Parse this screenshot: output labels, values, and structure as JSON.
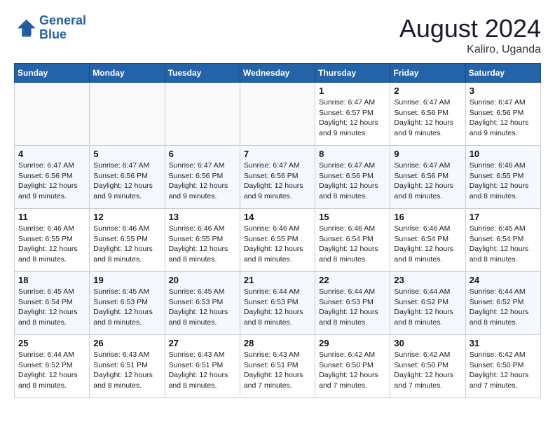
{
  "header": {
    "logo_text_general": "General",
    "logo_text_blue": "Blue",
    "month_year": "August 2024",
    "location": "Kaliro, Uganda"
  },
  "weekdays": [
    "Sunday",
    "Monday",
    "Tuesday",
    "Wednesday",
    "Thursday",
    "Friday",
    "Saturday"
  ],
  "weeks": [
    [
      {
        "day": "",
        "info": ""
      },
      {
        "day": "",
        "info": ""
      },
      {
        "day": "",
        "info": ""
      },
      {
        "day": "",
        "info": ""
      },
      {
        "day": "1",
        "info": "Sunrise: 6:47 AM\nSunset: 6:57 PM\nDaylight: 12 hours and 9 minutes."
      },
      {
        "day": "2",
        "info": "Sunrise: 6:47 AM\nSunset: 6:56 PM\nDaylight: 12 hours and 9 minutes."
      },
      {
        "day": "3",
        "info": "Sunrise: 6:47 AM\nSunset: 6:56 PM\nDaylight: 12 hours and 9 minutes."
      }
    ],
    [
      {
        "day": "4",
        "info": "Sunrise: 6:47 AM\nSunset: 6:56 PM\nDaylight: 12 hours and 9 minutes."
      },
      {
        "day": "5",
        "info": "Sunrise: 6:47 AM\nSunset: 6:56 PM\nDaylight: 12 hours and 9 minutes."
      },
      {
        "day": "6",
        "info": "Sunrise: 6:47 AM\nSunset: 6:56 PM\nDaylight: 12 hours and 9 minutes."
      },
      {
        "day": "7",
        "info": "Sunrise: 6:47 AM\nSunset: 6:56 PM\nDaylight: 12 hours and 9 minutes."
      },
      {
        "day": "8",
        "info": "Sunrise: 6:47 AM\nSunset: 6:56 PM\nDaylight: 12 hours and 8 minutes."
      },
      {
        "day": "9",
        "info": "Sunrise: 6:47 AM\nSunset: 6:56 PM\nDaylight: 12 hours and 8 minutes."
      },
      {
        "day": "10",
        "info": "Sunrise: 6:46 AM\nSunset: 6:55 PM\nDaylight: 12 hours and 8 minutes."
      }
    ],
    [
      {
        "day": "11",
        "info": "Sunrise: 6:46 AM\nSunset: 6:55 PM\nDaylight: 12 hours and 8 minutes."
      },
      {
        "day": "12",
        "info": "Sunrise: 6:46 AM\nSunset: 6:55 PM\nDaylight: 12 hours and 8 minutes."
      },
      {
        "day": "13",
        "info": "Sunrise: 6:46 AM\nSunset: 6:55 PM\nDaylight: 12 hours and 8 minutes."
      },
      {
        "day": "14",
        "info": "Sunrise: 6:46 AM\nSunset: 6:55 PM\nDaylight: 12 hours and 8 minutes."
      },
      {
        "day": "15",
        "info": "Sunrise: 6:46 AM\nSunset: 6:54 PM\nDaylight: 12 hours and 8 minutes."
      },
      {
        "day": "16",
        "info": "Sunrise: 6:46 AM\nSunset: 6:54 PM\nDaylight: 12 hours and 8 minutes."
      },
      {
        "day": "17",
        "info": "Sunrise: 6:45 AM\nSunset: 6:54 PM\nDaylight: 12 hours and 8 minutes."
      }
    ],
    [
      {
        "day": "18",
        "info": "Sunrise: 6:45 AM\nSunset: 6:54 PM\nDaylight: 12 hours and 8 minutes."
      },
      {
        "day": "19",
        "info": "Sunrise: 6:45 AM\nSunset: 6:53 PM\nDaylight: 12 hours and 8 minutes."
      },
      {
        "day": "20",
        "info": "Sunrise: 6:45 AM\nSunset: 6:53 PM\nDaylight: 12 hours and 8 minutes."
      },
      {
        "day": "21",
        "info": "Sunrise: 6:44 AM\nSunset: 6:53 PM\nDaylight: 12 hours and 8 minutes."
      },
      {
        "day": "22",
        "info": "Sunrise: 6:44 AM\nSunset: 6:53 PM\nDaylight: 12 hours and 8 minutes."
      },
      {
        "day": "23",
        "info": "Sunrise: 6:44 AM\nSunset: 6:52 PM\nDaylight: 12 hours and 8 minutes."
      },
      {
        "day": "24",
        "info": "Sunrise: 6:44 AM\nSunset: 6:52 PM\nDaylight: 12 hours and 8 minutes."
      }
    ],
    [
      {
        "day": "25",
        "info": "Sunrise: 6:44 AM\nSunset: 6:52 PM\nDaylight: 12 hours and 8 minutes."
      },
      {
        "day": "26",
        "info": "Sunrise: 6:43 AM\nSunset: 6:51 PM\nDaylight: 12 hours and 8 minutes."
      },
      {
        "day": "27",
        "info": "Sunrise: 6:43 AM\nSunset: 6:51 PM\nDaylight: 12 hours and 8 minutes."
      },
      {
        "day": "28",
        "info": "Sunrise: 6:43 AM\nSunset: 6:51 PM\nDaylight: 12 hours and 7 minutes."
      },
      {
        "day": "29",
        "info": "Sunrise: 6:42 AM\nSunset: 6:50 PM\nDaylight: 12 hours and 7 minutes."
      },
      {
        "day": "30",
        "info": "Sunrise: 6:42 AM\nSunset: 6:50 PM\nDaylight: 12 hours and 7 minutes."
      },
      {
        "day": "31",
        "info": "Sunrise: 6:42 AM\nSunset: 6:50 PM\nDaylight: 12 hours and 7 minutes."
      }
    ]
  ]
}
